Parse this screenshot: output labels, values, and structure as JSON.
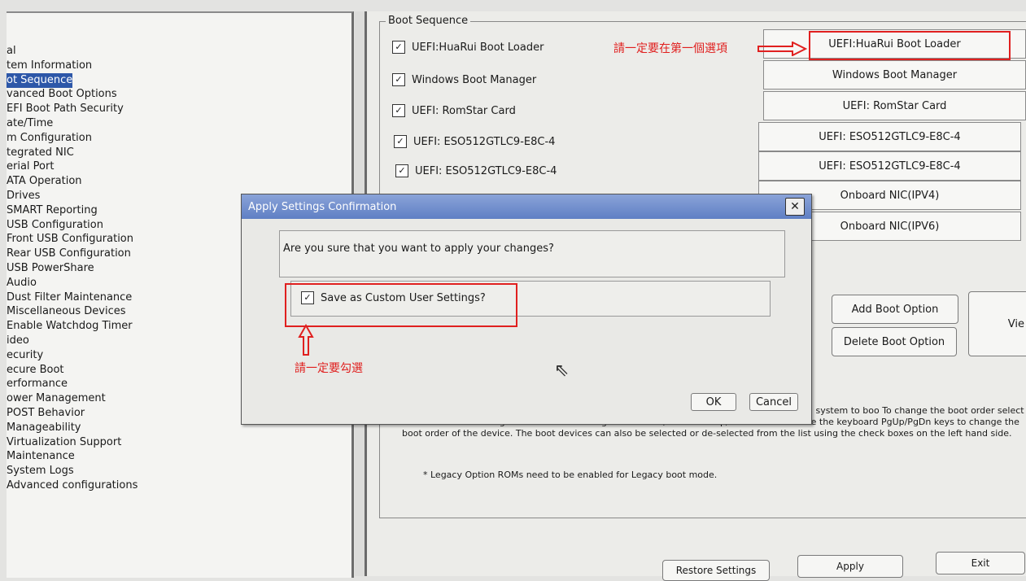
{
  "tree_items": [
    {
      "label": "al",
      "selected": false
    },
    {
      "label": "tem Information",
      "selected": false
    },
    {
      "label": "ot Sequence",
      "selected": true
    },
    {
      "label": "vanced Boot Options",
      "selected": false
    },
    {
      "label": "EFI Boot Path Security",
      "selected": false
    },
    {
      "label": "ate/Time",
      "selected": false
    },
    {
      "label": "m Configuration",
      "selected": false
    },
    {
      "label": "tegrated NIC",
      "selected": false
    },
    {
      "label": "erial Port",
      "selected": false
    },
    {
      "label": "ATA Operation",
      "selected": false
    },
    {
      "label": "Drives",
      "selected": false
    },
    {
      "label": "SMART Reporting",
      "selected": false
    },
    {
      "label": "USB Configuration",
      "selected": false
    },
    {
      "label": "Front USB Configuration",
      "selected": false
    },
    {
      "label": "Rear USB Configuration",
      "selected": false
    },
    {
      "label": "USB PowerShare",
      "selected": false
    },
    {
      "label": "Audio",
      "selected": false
    },
    {
      "label": "Dust Filter Maintenance",
      "selected": false
    },
    {
      "label": "Miscellaneous Devices",
      "selected": false
    },
    {
      "label": "Enable Watchdog Timer",
      "selected": false
    },
    {
      "label": "ideo",
      "selected": false
    },
    {
      "label": "ecurity",
      "selected": false
    },
    {
      "label": "ecure Boot",
      "selected": false
    },
    {
      "label": "erformance",
      "selected": false
    },
    {
      "label": "ower Management",
      "selected": false
    },
    {
      "label": "POST Behavior",
      "selected": false
    },
    {
      "label": "Manageability",
      "selected": false
    },
    {
      "label": "Virtualization Support",
      "selected": false
    },
    {
      "label": "Maintenance",
      "selected": false
    },
    {
      "label": "System Logs",
      "selected": false
    },
    {
      "label": "Advanced configurations",
      "selected": false
    }
  ],
  "boot_sequence": {
    "legend": "Boot Sequence",
    "checkbox_items": [
      {
        "label": "UEFI:HuaRui Boot Loader",
        "checked": true
      },
      {
        "label": "Windows Boot Manager",
        "checked": true
      },
      {
        "label": "UEFI: RomStar Card",
        "checked": true
      },
      {
        "label": "UEFI: ESO512GTLC9-E8C-4",
        "checked": true
      },
      {
        "label": "UEFI: ESO512GTLC9-E8C-4",
        "checked": true
      }
    ],
    "order_list": [
      "UEFI:HuaRui Boot Loader",
      "Windows Boot Manager",
      "UEFI: RomStar Card",
      "UEFI: ESO512GTLC9-E8C-4",
      "UEFI: ESO512GTLC9-E8C-4",
      "Onboard NIC(IPV4)",
      "Onboard NIC(IPV6)"
    ],
    "add_boot_option": "Add Boot Option",
    "delete_boot_option": "Delete Boot Option",
    "view_button": "Vie",
    "description": "This list specifies the order that the BIOS searches devices when trying to find an operating system to boo To change the boot order select the device to be changed in the list on the right hand side, then click up/down arrows or use the keyboard PgUp/PgDn keys to change the boot order of the device. The boot devices can also be selected or de-selected from the list using the check boxes on the left hand side.",
    "legacy_note": "* Legacy Option ROMs need to be enabled for Legacy boot mode."
  },
  "footer_buttons": {
    "restore": "Restore Settings",
    "apply": "Apply",
    "exit": "Exit"
  },
  "dialog": {
    "title": "Apply Settings Confirmation",
    "close_glyph": "✕",
    "message": "Are you sure that you want to apply your changes?",
    "save_label": "Save as Custom User Settings?",
    "save_checked": true,
    "ok": "OK",
    "cancel": "Cancel"
  },
  "annotations": {
    "top_note": "請一定要在第一個選項",
    "bottom_note": "請一定要勾選",
    "color": "#e0201f"
  },
  "icons": {
    "check": "✓",
    "cursor": "⇖"
  }
}
